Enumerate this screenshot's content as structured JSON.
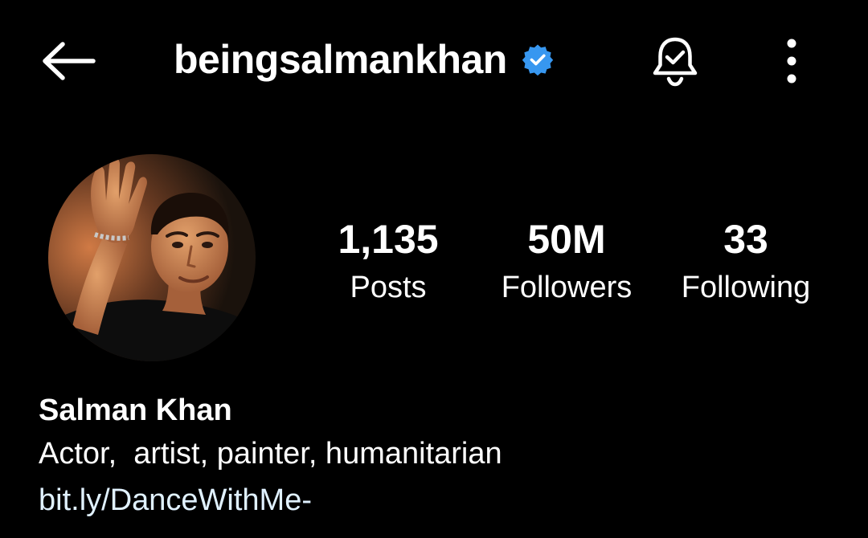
{
  "header": {
    "username": "beingsalmankhan",
    "icons": {
      "back": "arrow-left-icon",
      "verified": "verified-badge-icon",
      "notifications": "bell-check-icon",
      "more": "more-vertical-icon"
    }
  },
  "profile": {
    "avatar": "profile-photo",
    "stats": [
      {
        "value": "1,135",
        "label": "Posts"
      },
      {
        "value": "50M",
        "label": "Followers"
      },
      {
        "value": "33",
        "label": "Following"
      }
    ],
    "display_name": "Salman Khan",
    "bio": "Actor,  artist, painter, humanitarian",
    "link": "bit.ly/DanceWithMe-"
  },
  "colors": {
    "background": "#000000",
    "text": "#ffffff",
    "verified": "#3797f0",
    "link": "#e0f1ff"
  }
}
